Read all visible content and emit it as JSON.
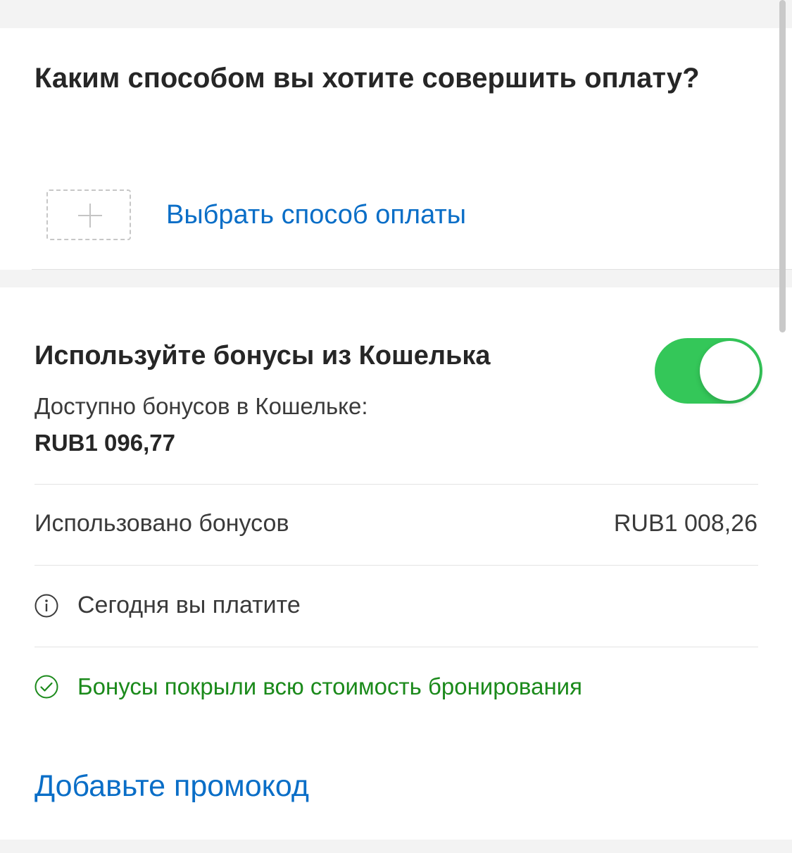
{
  "payment": {
    "title": "Каким способом вы хотите совершить оплату?",
    "add_method_label": "Выбрать способ оплаты"
  },
  "bonuses": {
    "title": "Используйте бонусы из Кошелька",
    "toggle_on": true,
    "available_label": "Доступно бонусов в Кошельке:",
    "available_amount": "RUB1 096,77",
    "used_label": "Использовано бонусов",
    "used_amount": "RUB1 008,26",
    "pay_today_label": "Сегодня вы платите",
    "covered_message": "Бонусы покрыли всю стоимость бронирования"
  },
  "promo": {
    "link_label": "Добавьте промокод"
  },
  "icons": {
    "add": "plus-icon",
    "info": "info-icon",
    "success": "check-circle-icon"
  },
  "colors": {
    "link": "#0a6ec7",
    "toggle_on": "#34c759",
    "success": "#1b8a1b"
  }
}
